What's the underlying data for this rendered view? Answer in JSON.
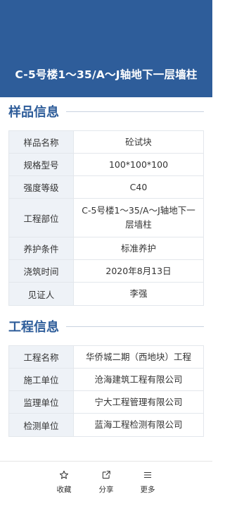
{
  "header": {
    "title": "C-5号楼1～35/A～J轴地下一层墙柱"
  },
  "sample_section": {
    "title": "样品信息",
    "rows": [
      {
        "label": "样品名称",
        "value": "砼试块"
      },
      {
        "label": "规格型号",
        "value": "100*100*100"
      },
      {
        "label": "强度等级",
        "value": "C40"
      },
      {
        "label": "工程部位",
        "value": "C-5号楼1～35/A～J轴地下一层墙柱"
      },
      {
        "label": "养护条件",
        "value": "标准养护"
      },
      {
        "label": "浇筑时间",
        "value": "2020年8月13日"
      },
      {
        "label": "见证人",
        "value": "李强"
      }
    ]
  },
  "project_section": {
    "title": "工程信息",
    "rows": [
      {
        "label": "工程名称",
        "value": "华侨城二期（西地块）工程"
      },
      {
        "label": "施工单位",
        "value": "沧海建筑工程有限公司"
      },
      {
        "label": "监理单位",
        "value": "宁大工程管理有限公司"
      },
      {
        "label": "检测单位",
        "value": "蓝海工程检测有限公司"
      }
    ]
  },
  "footer": {
    "items": [
      {
        "label": "收藏",
        "icon": "star-icon"
      },
      {
        "label": "分享",
        "icon": "share-icon"
      },
      {
        "label": "更多",
        "icon": "menu-icon"
      }
    ]
  },
  "colors": {
    "header_bg": "#2e5d9a",
    "section_title": "#2e5d9a",
    "label_bg": "#eef2f7"
  }
}
